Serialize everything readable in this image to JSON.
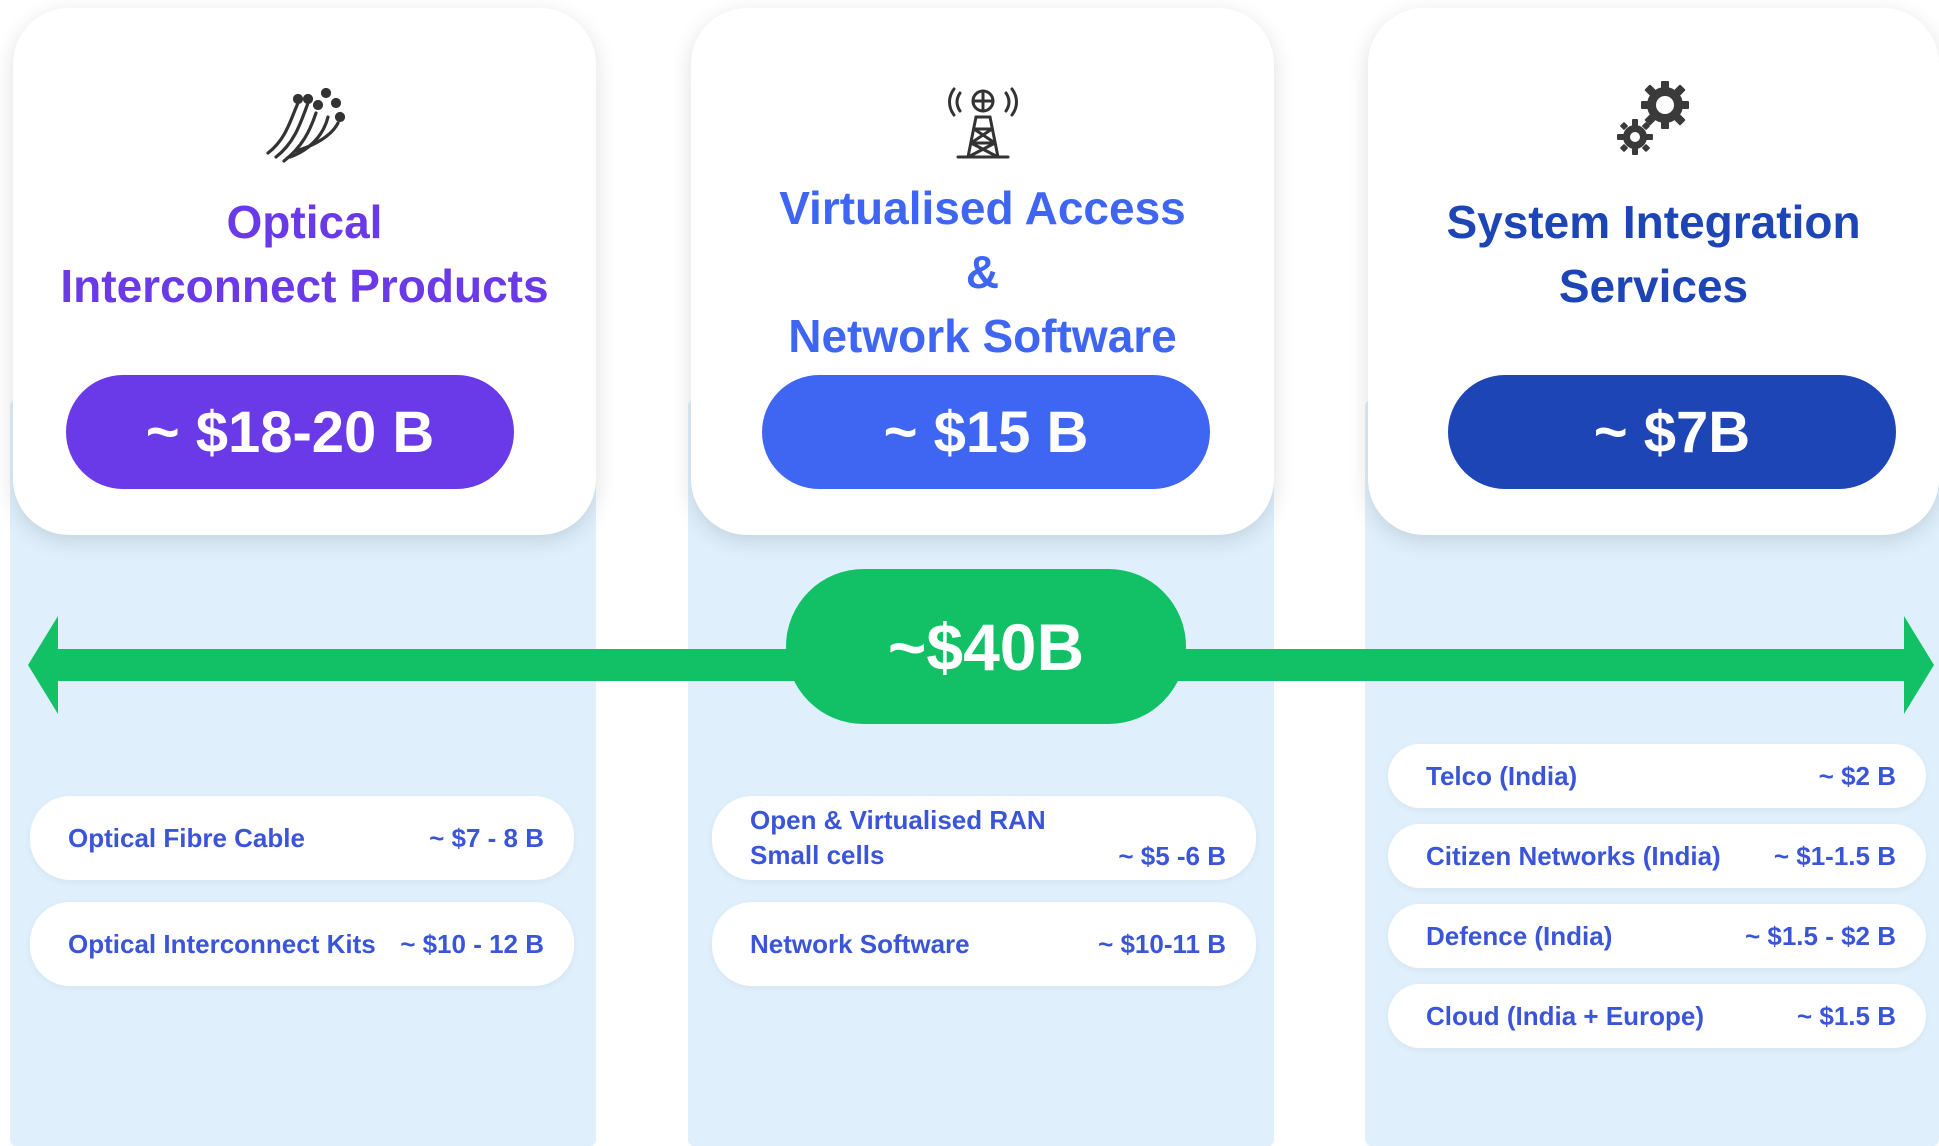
{
  "colors": {
    "optical": "#6a3ae8",
    "virtualised": "#3f66f2",
    "system": "#1d45b6",
    "total": "#12c065",
    "column_background": "#dff0fc",
    "segment_text": "#3a55d8"
  },
  "columns": [
    {
      "icon": "fiber-optic-icon",
      "title_lines": [
        "Optical",
        "Interconnect Products"
      ],
      "market_size": "~ $18-20 B",
      "segments": [
        {
          "label": "Optical Fibre Cable",
          "value": "~ $7 - 8 B"
        },
        {
          "label": "Optical Interconnect Kits",
          "value": "~ $10 - 12 B"
        }
      ]
    },
    {
      "icon": "cell-tower-icon",
      "title_lines": [
        "Virtualised Access",
        "&",
        "Network Software"
      ],
      "market_size": "~ $15 B",
      "segments": [
        {
          "label": "Open & Virtualised RAN\nSmall cells",
          "value": "~ $5 -6 B"
        },
        {
          "label": "Network Software",
          "value": "~ $10-11 B"
        }
      ]
    },
    {
      "icon": "gears-icon",
      "title_lines": [
        "System Integration",
        "Services"
      ],
      "market_size": "~ $7B",
      "segments": [
        {
          "label": "Telco (India)",
          "value": "~ $2 B"
        },
        {
          "label": "Citizen Networks (India)",
          "value": "~  $1-1.5 B"
        },
        {
          "label": "Defence (India)",
          "value": "~  $1.5 - $2 B"
        },
        {
          "label": "Cloud (India + Europe)",
          "value": "~ $1.5 B"
        }
      ]
    }
  ],
  "total": {
    "label": "~$40B"
  }
}
